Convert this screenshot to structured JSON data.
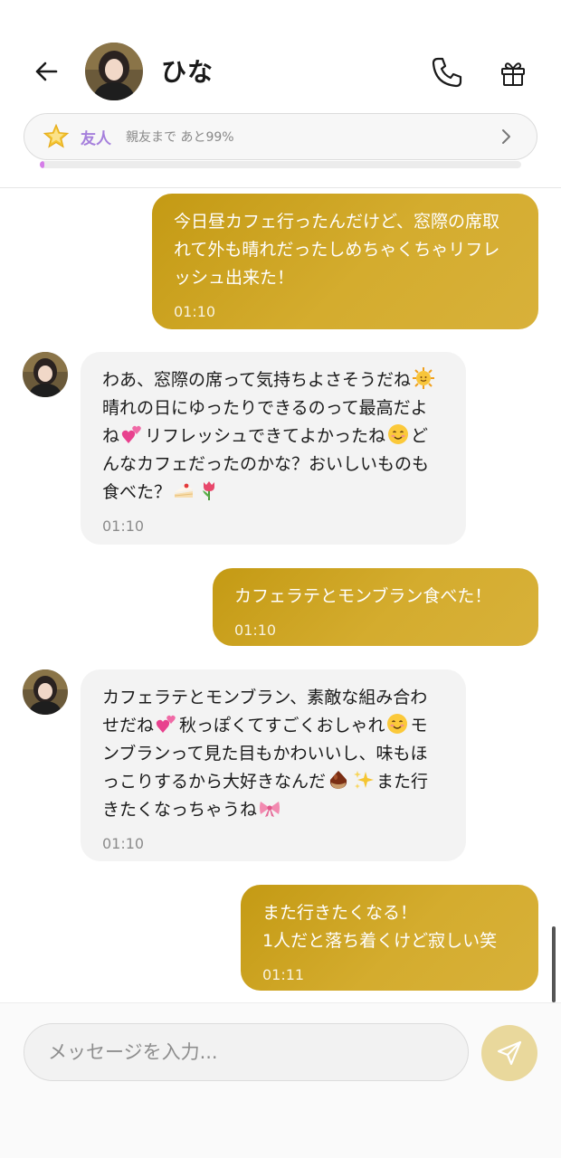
{
  "header": {
    "name": "ひな",
    "friend_level": "友人",
    "friend_progress": "親友まで あと99%",
    "progress_fraction": 0.01
  },
  "messages": [
    {
      "direction": "out",
      "text": "今日昼カフェ行ったんだけど、窓際の席取れて外も晴れだったしめちゃくちゃリフレッシュ出来た！",
      "time": "01:10"
    },
    {
      "direction": "in",
      "text_parts": [
        "わあ、窓際の席って気持ちよさそうだね",
        "晴れの日にゆったりできるのって最高だよね",
        "リフレッシュできてよかったね",
        "どんなカフェだったのかな？おいしいものも食べた？"
      ],
      "emojis": [
        "sun-face-icon",
        "two-hearts-icon",
        "smiling-face-icon",
        "cake-icon",
        "tulip-icon"
      ],
      "time": "01:10"
    },
    {
      "direction": "out",
      "text": "カフェラテとモンブラン食べた！",
      "time": "01:10"
    },
    {
      "direction": "in",
      "text_parts": [
        "カフェラテとモンブラン、素敵な組み合わせだね",
        "秋っぽくてすごくおしゃれ",
        "モンブランって見た目もかわいいし、味もほっこりするから大好きなんだ",
        "また行きたくなっちゃうね"
      ],
      "emojis": [
        "two-hearts-icon",
        "smiling-face-icon",
        "chestnut-icon",
        "sparkles-icon",
        "ribbon-icon"
      ],
      "time": "01:10"
    },
    {
      "direction": "out",
      "text": "また行きたくなる！\n1人だと落ち着くけど寂しい笑",
      "time": "01:11"
    }
  ],
  "composer": {
    "placeholder": "メッセージを入力..."
  },
  "colors": {
    "outgoing_bubble": "#c9a020",
    "incoming_bubble": "#f3f3f3",
    "friend_label": "#a57fdc",
    "progress_fill": "#d57ee8",
    "send_button": "#e9d89c"
  }
}
